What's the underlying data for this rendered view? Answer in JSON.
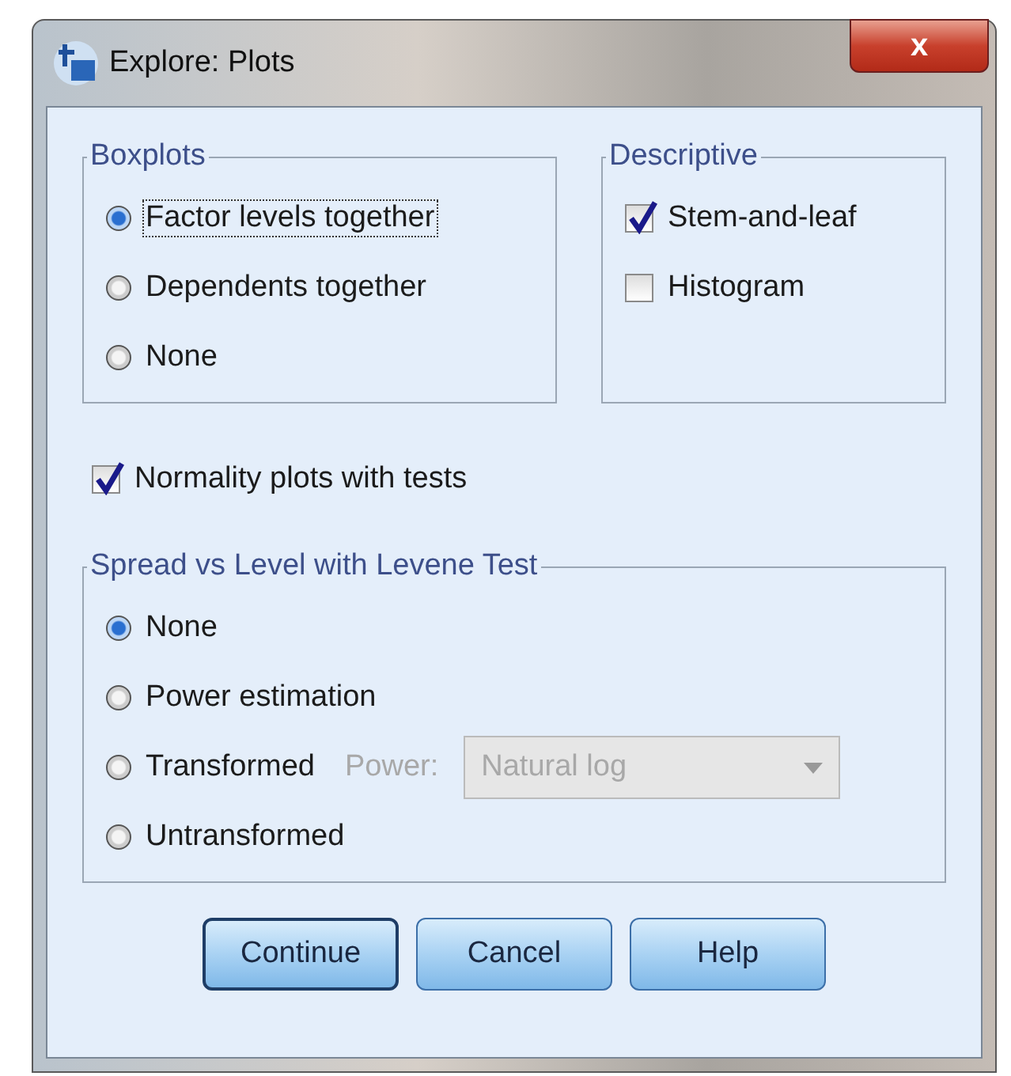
{
  "window": {
    "title": "Explore: Plots",
    "close": "x"
  },
  "boxplots": {
    "title": "Boxplots",
    "options": [
      {
        "label": "Factor levels together",
        "selected": true,
        "focused": true
      },
      {
        "label": "Dependents together",
        "selected": false,
        "focused": false
      },
      {
        "label": "None",
        "selected": false,
        "focused": false
      }
    ]
  },
  "descriptive": {
    "title": "Descriptive",
    "options": [
      {
        "label": "Stem-and-leaf",
        "checked": true
      },
      {
        "label": "Histogram",
        "checked": false
      }
    ]
  },
  "normality": {
    "label": "Normality plots with tests",
    "checked": true
  },
  "spread": {
    "title": "Spread vs Level with Levene Test",
    "options": [
      {
        "label": "None",
        "selected": true
      },
      {
        "label": "Power estimation",
        "selected": false
      },
      {
        "label": "Transformed",
        "selected": false
      },
      {
        "label": "Untransformed",
        "selected": false
      }
    ],
    "power": {
      "label": "Power:",
      "value": "Natural log",
      "disabled": true
    }
  },
  "buttons": [
    {
      "label": "Continue",
      "default": true
    },
    {
      "label": "Cancel",
      "default": false
    },
    {
      "label": "Help",
      "default": false
    }
  ]
}
